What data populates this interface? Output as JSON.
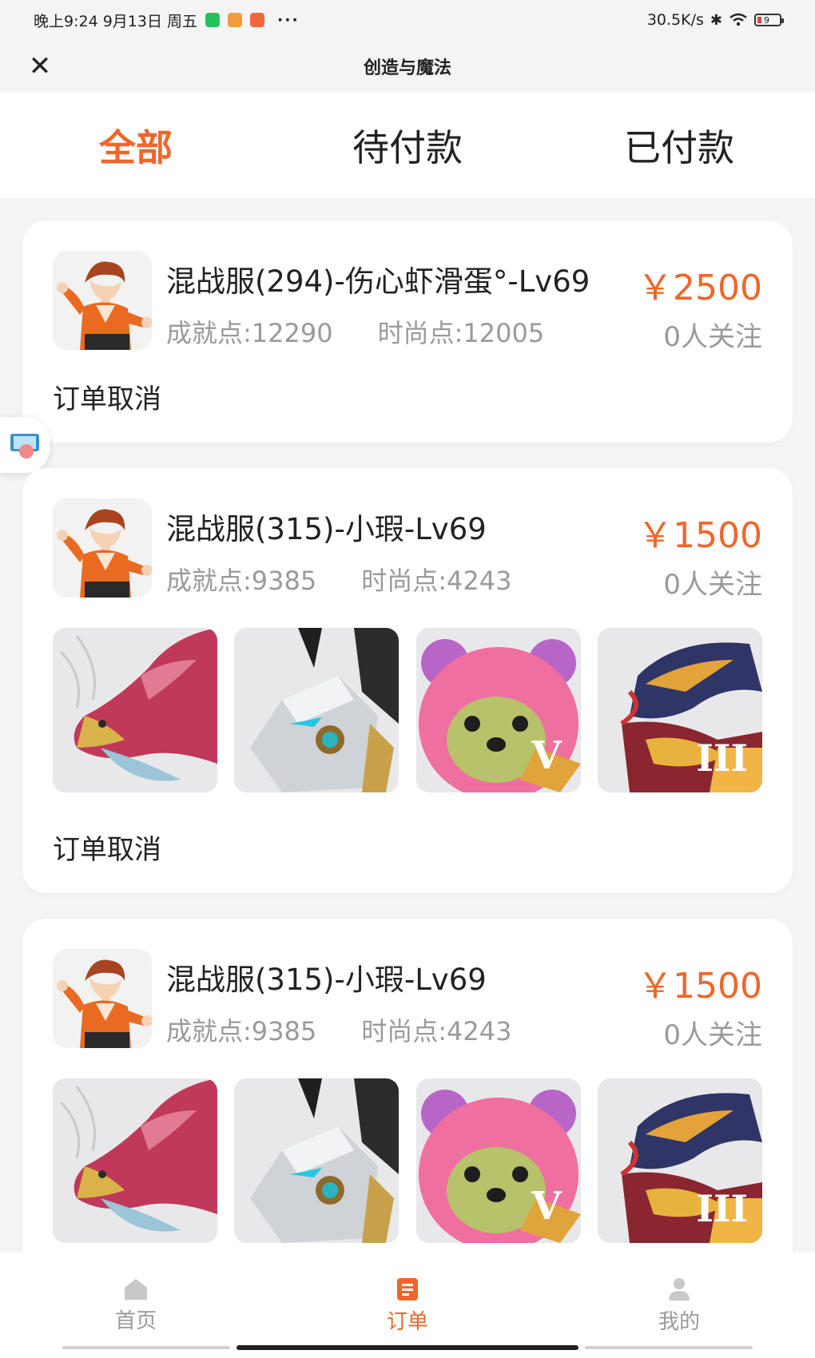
{
  "status_bar": {
    "left_text": "晚上9:24 9月13日 周五",
    "dots": "···",
    "net_speed": "30.5K/s",
    "battery": "9"
  },
  "nav": {
    "title": "创造与魔法"
  },
  "tabs": [
    {
      "label": "全部",
      "active": true
    },
    {
      "label": "待付款",
      "active": false
    },
    {
      "label": "已付款",
      "active": false
    }
  ],
  "orders": [
    {
      "title": "混战服(294)-伤心虾滑蛋°-Lv69",
      "achievement": "成就点:12290",
      "fashion": "时尚点:12005",
      "price": "￥2500",
      "follows": "0人关注",
      "status": "订单取消"
    },
    {
      "title": "混战服(315)-小瑕-Lv69",
      "achievement": "成就点:9385",
      "fashion": "时尚点:4243",
      "price": "￥1500",
      "follows": "0人关注",
      "status": "订单取消"
    },
    {
      "title": "混战服(315)-小瑕-Lv69",
      "achievement": "成就点:9385",
      "fashion": "时尚点:4243",
      "price": "￥1500",
      "follows": "0人关注"
    }
  ],
  "thumb_badges": [
    "V",
    "III"
  ],
  "bottom_nav": [
    {
      "label": "首页",
      "icon": "home-icon"
    },
    {
      "label": "订单",
      "icon": "order-icon",
      "active": true
    },
    {
      "label": "我的",
      "icon": "profile-icon"
    }
  ],
  "colors": {
    "accent": "#f0662a",
    "background": "#f4f4f5",
    "muted": "#9a9a9a"
  }
}
